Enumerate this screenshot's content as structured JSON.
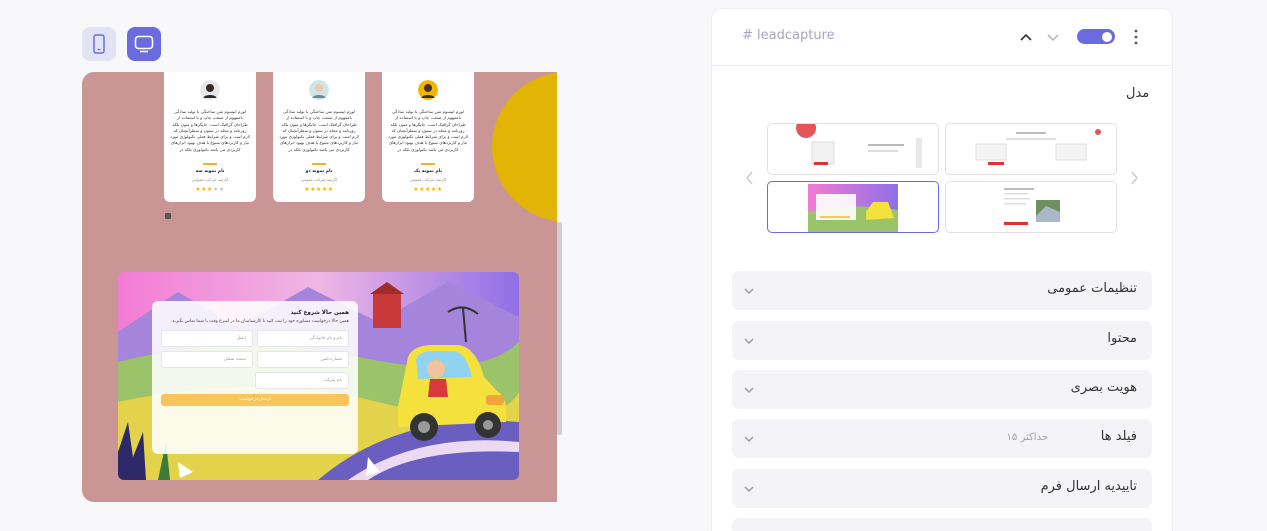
{
  "toolbar": {
    "mobile_icon": "mobile-icon",
    "desktop_icon": "desktop-icon"
  },
  "preview": {
    "testimonials": [
      {
        "text": "لورم ایپسوم متن ساختگی با تولید سادگی نامفهوم از صنعت چاپ و با استفاده از طراحان گرافیک است. چاپگرها و متون بلکه روزنامه و مجله در ستون و سطرآنچنان که لازم است و برای شرایط فعلی تکنولوژی مورد نیاز و کاربردهای متنوع با هدف بهبود ابزارهای کاربردی می باشد تکنولوژی بلکه در",
        "name": "نام نمونه یک",
        "role": "کارمند شرکت عمومی",
        "stars": 5
      },
      {
        "text": "لورم ایپسوم متن ساختگی با تولید سادگی نامفهوم از صنعت چاپ و با استفاده از طراحان گرافیک است. چاپگرها و متون بلکه روزنامه و مجله در ستون و سطرآنچنان که لازم است و برای شرایط فعلی تکنولوژی مورد نیاز و کاربردهای متنوع با هدف بهبود ابزارهای کاربردی می باشد تکنولوژی بلکه در",
        "name": "نام نمونه دو",
        "role": "کارمند شرکت عمومی",
        "stars": 5
      },
      {
        "text": "لورم ایپسوم متن ساختگی با تولید سادگی نامفهوم از صنعت چاپ و با استفاده از طراحان گرافیک است. چاپگرها و متون بلکه روزنامه و مجله در ستون و سطرآنچنان که لازم است و برای شرایط فعلی تکنولوژی مورد نیاز و کاربردهای متنوع با هدف بهبود ابزارهای کاربردی می باشد تکنولوژی بلکه در",
        "name": "نام نمونه سه",
        "role": "کارمند شرکت عمومی",
        "stars": 3
      }
    ],
    "form": {
      "title": "همین حالا شروع کنید",
      "description": "همین حالا درخواست مشاوره خود را ثبت کنید تا کارشناسان ما در اسرع وقت با شما تماس بگیرند.",
      "fields": {
        "name": "نام و نام خانوادگی",
        "email": "ایمیل",
        "phone": "شماره تلفن",
        "service": "سمت شغلی",
        "company": "نام شرکت"
      },
      "submit": "ارسال درخواست"
    }
  },
  "panel": {
    "tag": "# leadcapture",
    "toggle_on": true,
    "model_label": "مدل",
    "accordions": [
      {
        "label": "تنظیمات عمومی",
        "sub": ""
      },
      {
        "label": "محتوا",
        "sub": ""
      },
      {
        "label": "هویت بصری",
        "sub": ""
      },
      {
        "label": "فیلد ها",
        "sub": "حداکثر ۱۵"
      },
      {
        "label": "تاییدیه ارسال فرم",
        "sub": ""
      }
    ]
  },
  "colors": {
    "accent": "#6b6be0",
    "preview_bg": "#c99595",
    "sun": "#e1b406",
    "submit": "#f7c55b"
  }
}
